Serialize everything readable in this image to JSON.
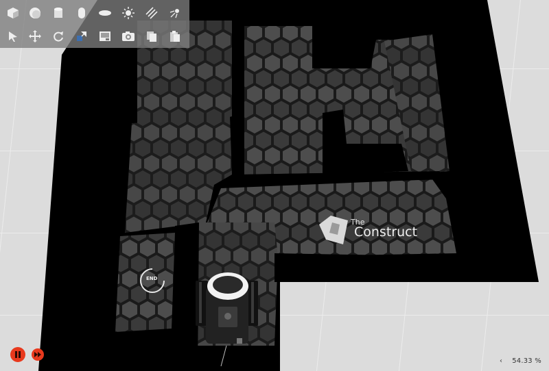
{
  "toolbar": {
    "row1": [
      "box-tool",
      "sphere-tool",
      "cylinder-tool",
      "capsule-tool",
      "ellipsoid-tool",
      "sun-light-tool",
      "directional-light-tool",
      "spot-light-tool"
    ],
    "row2": [
      "select-arrow-tool",
      "translate-tool",
      "rotate-tool",
      "scale-tool",
      "screenshot-tool",
      "camera-tool",
      "copy-tool",
      "paste-tool"
    ]
  },
  "scene": {
    "logo_the": "The",
    "logo_main": "Construct",
    "end_label": "END",
    "colors": {
      "ground": "#dcdcdc",
      "wall": "#000000",
      "floor": "#1e1e1e",
      "hex_light": "#444444",
      "hex_dark": "#2f2f2f"
    }
  },
  "controls": {
    "pause_icon": "pause-icon",
    "step_icon": "fast-forward-icon",
    "accent": "#e8391d"
  },
  "status": {
    "prev_symbol": "‹",
    "zoom_value": "54.33 %"
  }
}
